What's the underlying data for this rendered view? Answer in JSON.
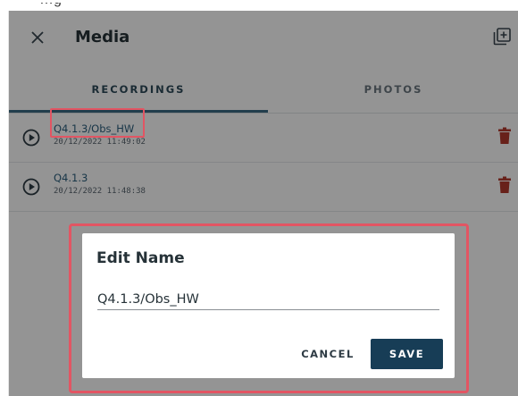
{
  "top_strip": {
    "ghost_text": "…g"
  },
  "header": {
    "title": "Media",
    "close_icon": "close-icon",
    "add_icon": "add-box-icon"
  },
  "tabs": [
    {
      "label": "RECORDINGS",
      "active": true
    },
    {
      "label": "PHOTOS",
      "active": false
    }
  ],
  "recordings": [
    {
      "name": "Q4.1.3/Obs_HW",
      "date": "20/12/2022 11:49:02"
    },
    {
      "name": "Q4.1.3",
      "date": "20/12/2022 11:48:38"
    }
  ],
  "dialog": {
    "title": "Edit Name",
    "input_value": "Q4.1.3/Obs_HW",
    "cancel_label": "CANCEL",
    "save_label": "SAVE"
  },
  "colors": {
    "accent": "#173d56",
    "tab_indicator": "#3c6b86",
    "delete": "#b33a2e",
    "highlight": "#e25563"
  }
}
